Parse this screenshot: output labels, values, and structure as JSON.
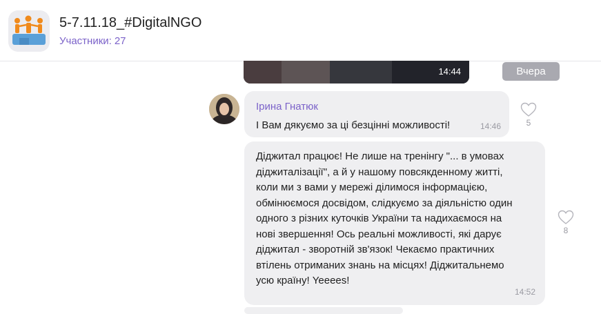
{
  "header": {
    "title": "5-7.11.18_#DigitalNGO",
    "participants_label": "Участники:",
    "participants_count": "27"
  },
  "divider": {
    "date_label": "Вчера"
  },
  "messages": [
    {
      "kind": "photo",
      "time": "14:44"
    },
    {
      "kind": "text",
      "sender": "Ірина Гнатюк",
      "text": "І Вам дякуємо за ці безцінні можливості!",
      "time": "14:46",
      "likes": "5"
    },
    {
      "kind": "text",
      "text": "Діджитал працює! Не лише на тренінгу \"... в умовах\nдіджиталізації\", а й у нашому повсякденному житті,\nколи ми з вами у мережі ділимося інформацією,\nобмінюємося досвідом, слідкуємо за діяльністю один\nодного з різних куточків України та надихаємося на\nнові звершення! Ось реальні можливості, які дарує\nдіджитал - зворотній зв'язок! Чекаємо практичних\nвтілень отриманих знань на місцях! Діджитальнемо\nусю країну! Yeeees!",
      "time": "14:52",
      "likes": "8"
    }
  ],
  "icons": {
    "group_avatar": "people-puzzle-icon",
    "like": "heart-icon"
  },
  "colors": {
    "accent": "#7b62c9",
    "bubble": "#efeff1",
    "date_pill": "#a9a9b0"
  }
}
